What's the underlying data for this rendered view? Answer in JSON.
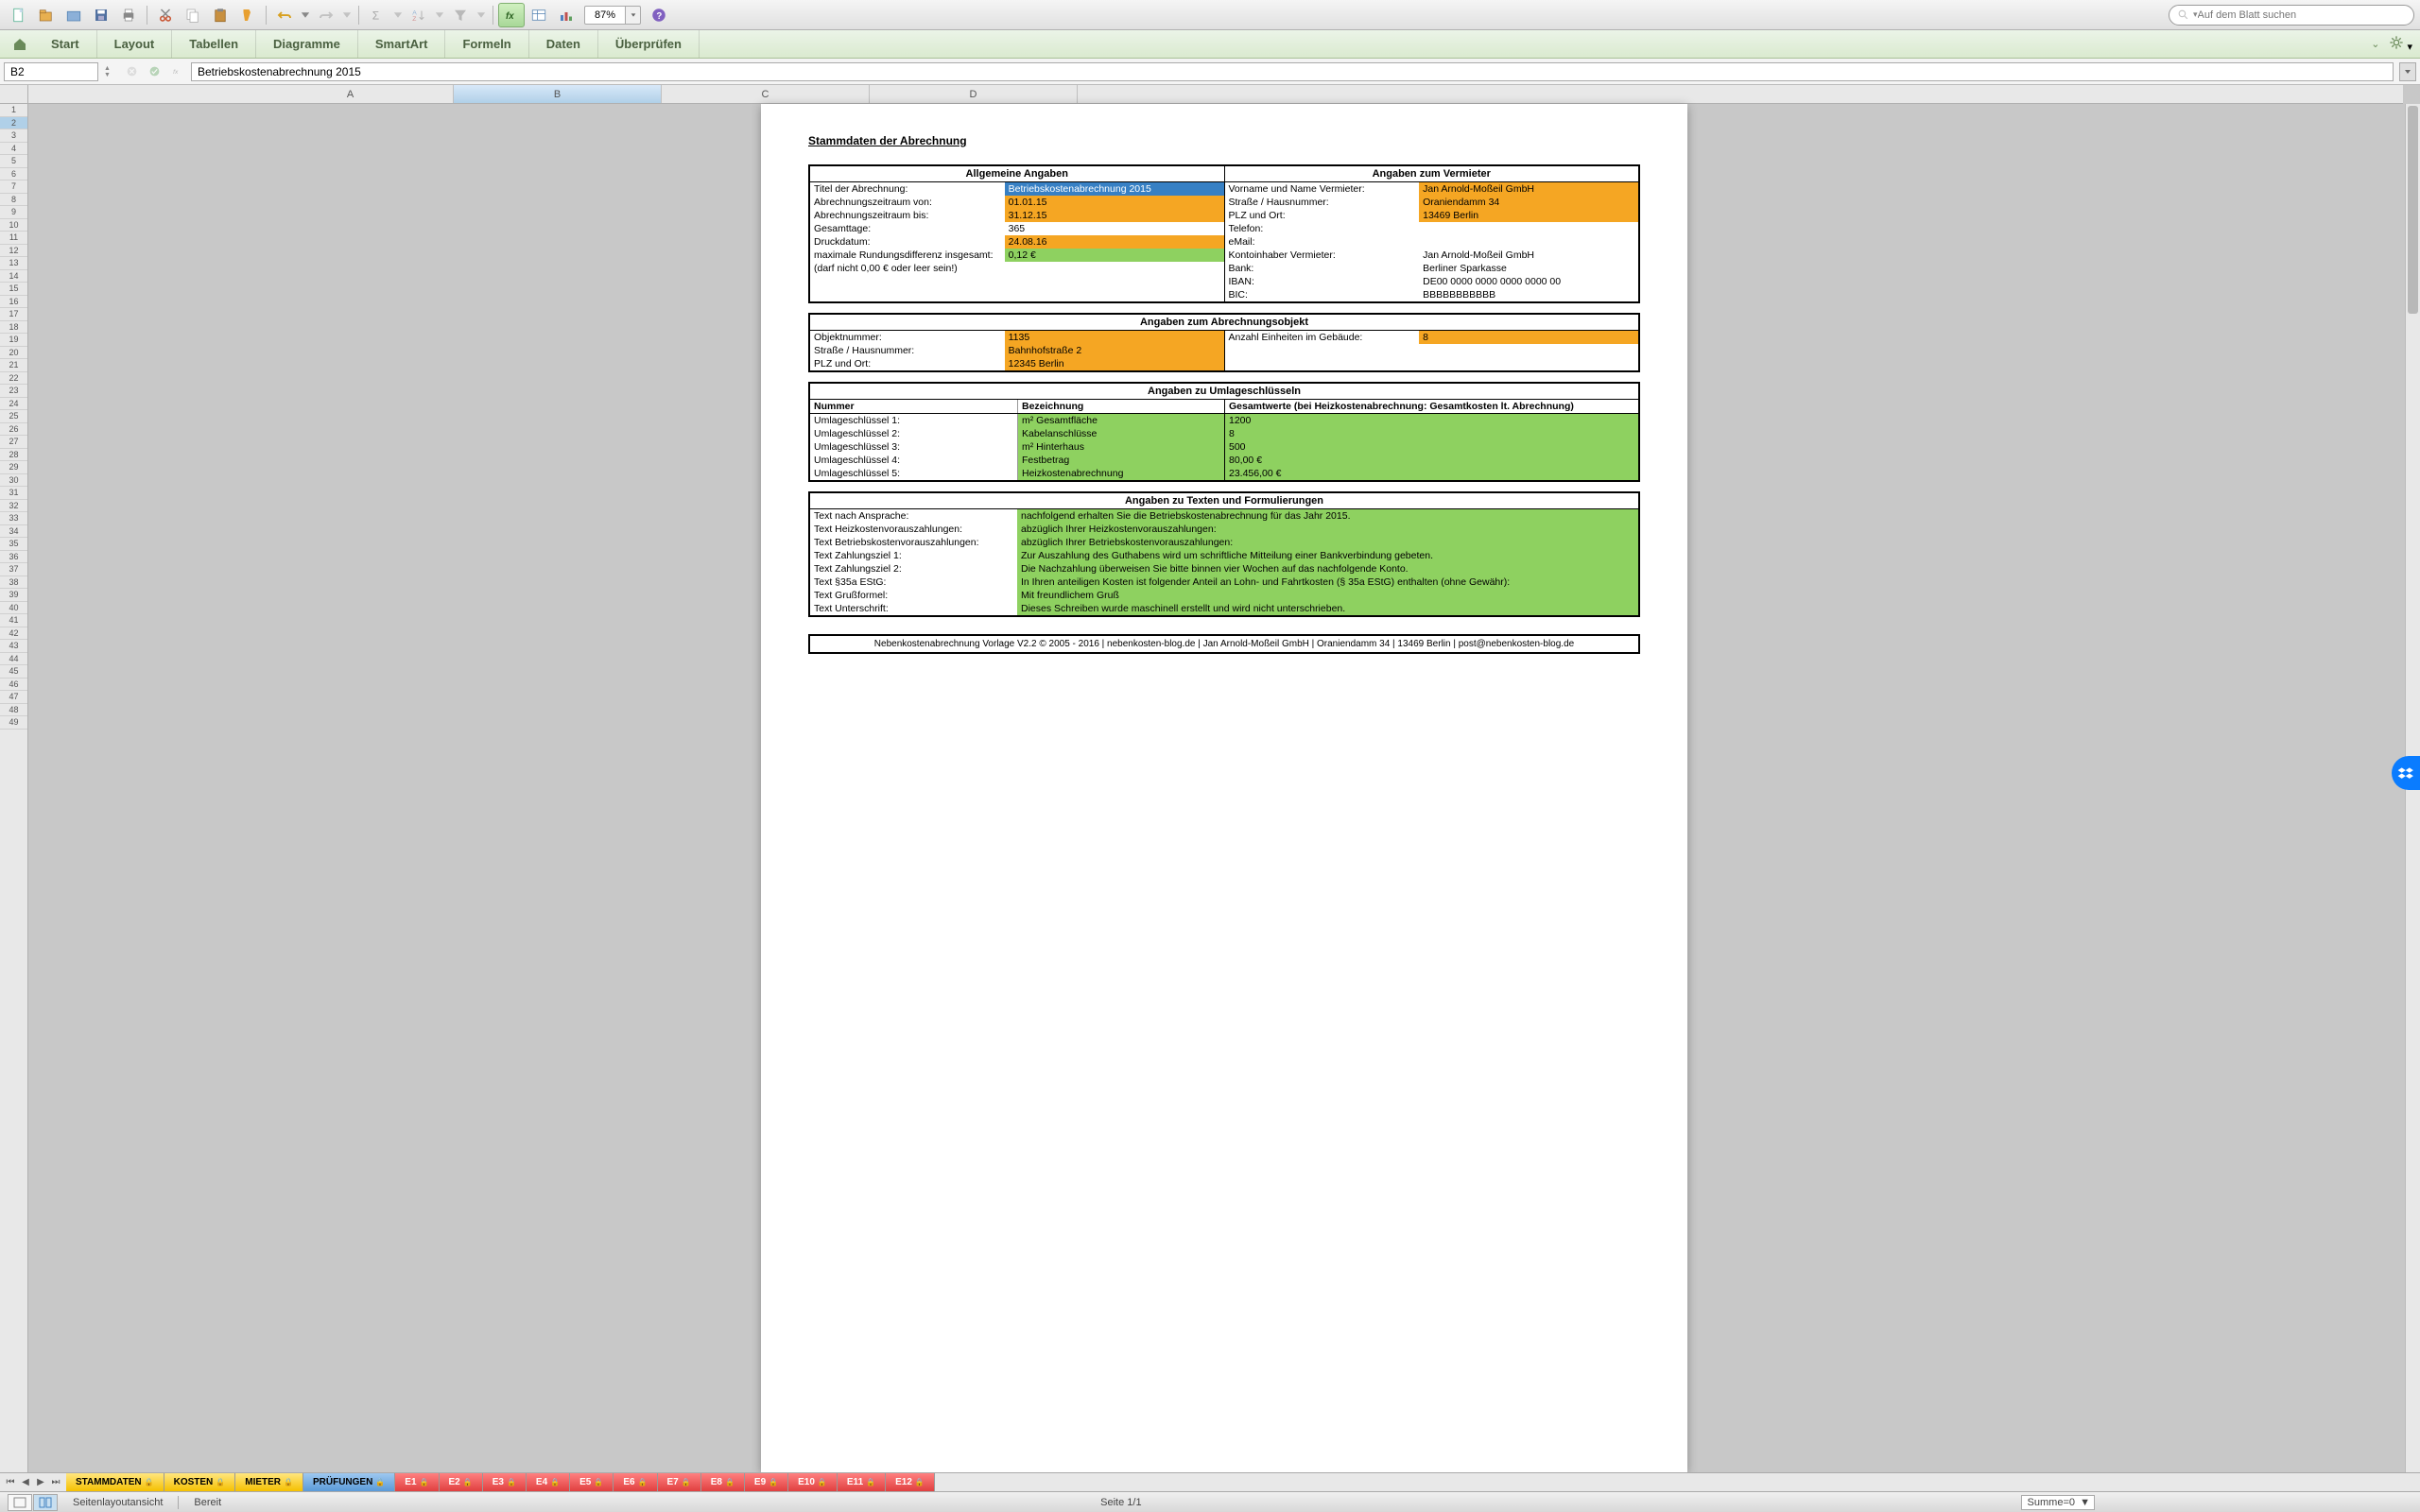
{
  "toolbar": {
    "zoom": "87%"
  },
  "search": {
    "placeholder": "Auf dem Blatt suchen"
  },
  "ribbon": {
    "tabs": [
      "Start",
      "Layout",
      "Tabellen",
      "Diagramme",
      "SmartArt",
      "Formeln",
      "Daten",
      "Überprüfen"
    ]
  },
  "formula": {
    "cell": "B2",
    "value": "Betriebskostenabrechnung 2015"
  },
  "columns": [
    "A",
    "B",
    "C",
    "D"
  ],
  "rows_max": 49,
  "page": {
    "title": "Stammdaten der Abrechnung",
    "b1": {
      "h1": "Allgemeine Angaben",
      "h2": "Angaben zum Vermieter",
      "left": [
        {
          "l": "Titel der Abrechnung:",
          "v": "Betriebskostenabrechnung 2015",
          "cls": "vsel"
        },
        {
          "l": "Abrechnungszeitraum von:",
          "v": "01.01.15",
          "cls": "vorange"
        },
        {
          "l": "Abrechnungszeitraum bis:",
          "v": "31.12.15",
          "cls": "vorange"
        },
        {
          "l": "Gesamttage:",
          "v": "365",
          "cls": ""
        },
        {
          "l": "Druckdatum:",
          "v": "24.08.16",
          "cls": "vorange"
        },
        {
          "l": "maximale Rundungsdifferenz insgesamt:",
          "v": "0,12 €",
          "cls": "vgreen"
        },
        {
          "l": "(darf nicht 0,00 € oder leer sein!)",
          "v": "",
          "cls": ""
        }
      ],
      "right": [
        {
          "l": "Vorname und Name Vermieter:",
          "v": "Jan Arnold-Moßeil GmbH",
          "cls": "vorange"
        },
        {
          "l": "Straße / Hausnummer:",
          "v": "Oraniendamm 34",
          "cls": "vorange"
        },
        {
          "l": "PLZ und Ort:",
          "v": "13469 Berlin",
          "cls": "vorange"
        },
        {
          "l": "Telefon:",
          "v": "",
          "cls": ""
        },
        {
          "l": "eMail:",
          "v": "",
          "cls": ""
        },
        {
          "l": "Kontoinhaber Vermieter:",
          "v": "Jan Arnold-Moßeil GmbH",
          "cls": ""
        },
        {
          "l": "Bank:",
          "v": "Berliner Sparkasse",
          "cls": ""
        },
        {
          "l": "IBAN:",
          "v": "DE00 0000 0000 0000 0000 00",
          "cls": ""
        },
        {
          "l": "BIC:",
          "v": "BBBBBBBBBBB",
          "cls": ""
        }
      ]
    },
    "b2": {
      "h": "Angaben zum Abrechnungsobjekt",
      "left": [
        {
          "l": "Objektnummer:",
          "v": "1135",
          "cls": "vorange"
        },
        {
          "l": "Straße / Hausnummer:",
          "v": "Bahnhofstraße 2",
          "cls": "vorange"
        },
        {
          "l": "PLZ und Ort:",
          "v": "12345 Berlin",
          "cls": "vorange"
        }
      ],
      "right": [
        {
          "l": "Anzahl Einheiten im Gebäude:",
          "v": "8",
          "cls": "vorange"
        }
      ]
    },
    "b3": {
      "h": "Angaben zu Umlageschlüsseln",
      "cols": [
        "Nummer",
        "Bezeichnung",
        "Gesamtwerte (bei Heizkostenabrechnung: Gesamtkosten lt. Abrechnung)"
      ],
      "rows": [
        {
          "n": "Umlageschlüssel 1:",
          "b": "m² Gesamtfläche",
          "w": "1200",
          "cls": "vgreen"
        },
        {
          "n": "Umlageschlüssel 2:",
          "b": "Kabelanschlüsse",
          "w": "8",
          "cls": "vgreen"
        },
        {
          "n": "Umlageschlüssel 3:",
          "b": "m² Hinterhaus",
          "w": "500",
          "cls": "vgreen"
        },
        {
          "n": "Umlageschlüssel 4:",
          "b": "Festbetrag",
          "w": "80,00 €",
          "cls": "vgreen"
        },
        {
          "n": "Umlageschlüssel 5:",
          "b": "Heizkostenabrechnung",
          "w": "23.456,00 €",
          "cls": "vgreen"
        }
      ]
    },
    "b4": {
      "h": "Angaben zu Texten und Formulierungen",
      "rows": [
        {
          "l": "Text nach Ansprache:",
          "v": "nachfolgend erhalten Sie die Betriebskostenabrechnung für das Jahr 2015."
        },
        {
          "l": "Text Heizkostenvorauszahlungen:",
          "v": "abzüglich Ihrer Heizkostenvorauszahlungen:"
        },
        {
          "l": "Text Betriebskostenvorauszahlungen:",
          "v": "abzüglich Ihrer Betriebskostenvorauszahlungen:"
        },
        {
          "l": "Text Zahlungsziel 1:",
          "v": "Zur Auszahlung des Guthabens wird um schriftliche Mitteilung einer Bankverbindung gebeten."
        },
        {
          "l": "Text Zahlungsziel 2:",
          "v": "Die Nachzahlung überweisen Sie bitte binnen vier Wochen auf das nachfolgende Konto."
        },
        {
          "l": "Text §35a EStG:",
          "v": "In Ihren anteiligen Kosten ist folgender Anteil an Lohn- und Fahrtkosten (§ 35a EStG) enthalten (ohne Gewähr):"
        },
        {
          "l": "Text Grußformel:",
          "v": "Mit freundlichem Gruß"
        },
        {
          "l": "Text Unterschrift:",
          "v": "Dieses Schreiben wurde maschinell erstellt und wird nicht unterschrieben."
        }
      ]
    },
    "footer": "Nebenkostenabrechnung Vorlage V2.2 © 2005 - 2016 | nebenkosten-blog.de | Jan Arnold-Moßeil GmbH | Oraniendamm 34 | 13469 Berlin | post@nebenkosten-blog.de"
  },
  "sheets": [
    {
      "n": "STAMMDATEN",
      "c": "y",
      "lock": true
    },
    {
      "n": "KOSTEN",
      "c": "y",
      "lock": true
    },
    {
      "n": "MIETER",
      "c": "y",
      "lock": true
    },
    {
      "n": "PRÜFUNGEN",
      "c": "b",
      "lock": true
    },
    {
      "n": "E1",
      "c": "r",
      "lock": true
    },
    {
      "n": "E2",
      "c": "r",
      "lock": true
    },
    {
      "n": "E3",
      "c": "r",
      "lock": true
    },
    {
      "n": "E4",
      "c": "r",
      "lock": true
    },
    {
      "n": "E5",
      "c": "r",
      "lock": true
    },
    {
      "n": "E6",
      "c": "r",
      "lock": true
    },
    {
      "n": "E7",
      "c": "r",
      "lock": true
    },
    {
      "n": "E8",
      "c": "r",
      "lock": true
    },
    {
      "n": "E9",
      "c": "r",
      "lock": true
    },
    {
      "n": "E10",
      "c": "r",
      "lock": true
    },
    {
      "n": "E11",
      "c": "r",
      "lock": true
    },
    {
      "n": "E12",
      "c": "r",
      "lock": true
    }
  ],
  "status": {
    "view": "Seitenlayoutansicht",
    "state": "Bereit",
    "page": "Seite 1/1",
    "sum": "Summe=0"
  }
}
